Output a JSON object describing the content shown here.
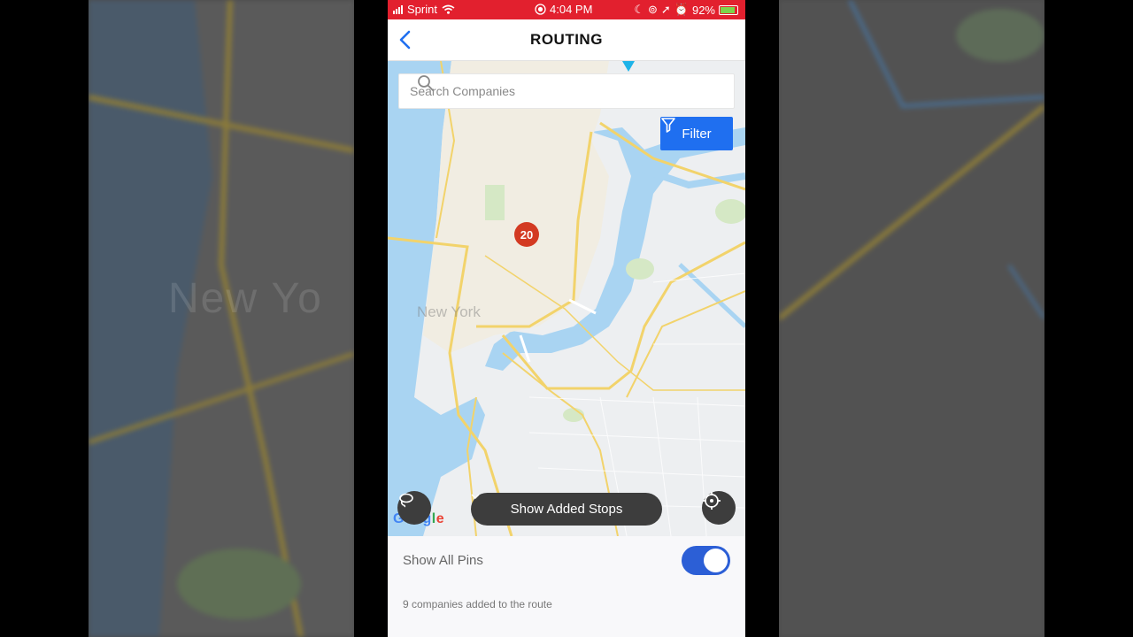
{
  "status_bar": {
    "carrier": "Sprint",
    "time": "4:04 PM",
    "battery": "92%"
  },
  "header": {
    "title": "ROUTING"
  },
  "search": {
    "placeholder": "Search Companies",
    "value": ""
  },
  "filter": {
    "label": "Filter"
  },
  "map": {
    "label_city": "New York",
    "cluster_count": "20",
    "attribution": "Google"
  },
  "controls": {
    "show_stops_label": "Show Added Stops"
  },
  "bottom": {
    "show_all_pins_label": "Show All Pins",
    "show_all_pins_on": true,
    "route_note": "9 companies added to the route"
  },
  "side_ghost_text": "New Yo",
  "colors": {
    "status_bar": "#e2202e",
    "accent": "#1f6ff0",
    "toggle_on": "#2c5fd6",
    "cluster": "#d33a22",
    "water": "#a9d4f2",
    "roads": "#f2d36b"
  }
}
